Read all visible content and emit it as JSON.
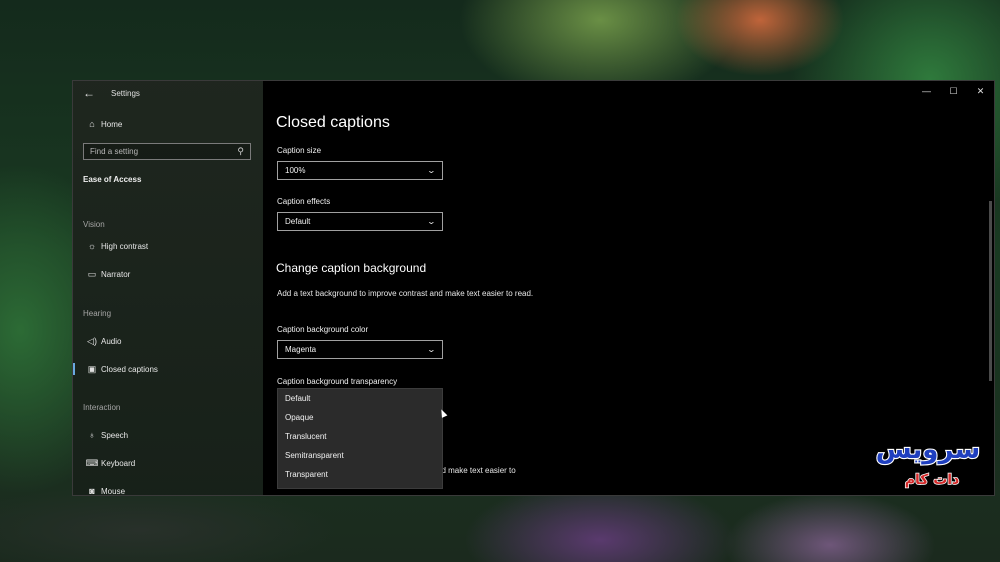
{
  "window": {
    "title": "Settings",
    "controls": {
      "minimize": "—",
      "maximize": "☐",
      "close": "✕"
    }
  },
  "sidebar": {
    "home_label": "Home",
    "search_placeholder": "Find a setting",
    "group_title": "Ease of Access",
    "sections": {
      "vision": "Vision",
      "hearing": "Hearing",
      "interaction": "Interaction"
    },
    "items": [
      {
        "label": "High contrast",
        "icon": "sun-icon"
      },
      {
        "label": "Narrator",
        "icon": "narrator-icon"
      },
      {
        "label": "Audio",
        "icon": "speaker-icon"
      },
      {
        "label": "Closed captions",
        "icon": "cc-icon",
        "selected": true
      },
      {
        "label": "Speech",
        "icon": "microphone-icon"
      },
      {
        "label": "Keyboard",
        "icon": "keyboard-icon"
      },
      {
        "label": "Mouse",
        "icon": "mouse-icon"
      }
    ]
  },
  "main": {
    "page_title": "Closed captions",
    "caption_size": {
      "label": "Caption size",
      "value": "100%"
    },
    "caption_effects": {
      "label": "Caption effects",
      "value": "Default"
    },
    "background_heading": "Change caption background",
    "background_desc": "Add a text background to improve contrast and make text easier to read.",
    "background_color": {
      "label": "Caption background color",
      "value": "Magenta"
    },
    "background_transparency": {
      "label": "Caption background transparency",
      "options": [
        "Default",
        "Opaque",
        "Translucent",
        "Semitransparent",
        "Transparent"
      ]
    },
    "partial_text_behind_dropdown": "nd make text easier to"
  },
  "watermark": {
    "line1": "سرویس",
    "line2": "دات کام"
  },
  "colors": {
    "accent": "#6aa9e0",
    "window_bg": "#000000",
    "dropdown_bg": "#2b2b2b"
  }
}
